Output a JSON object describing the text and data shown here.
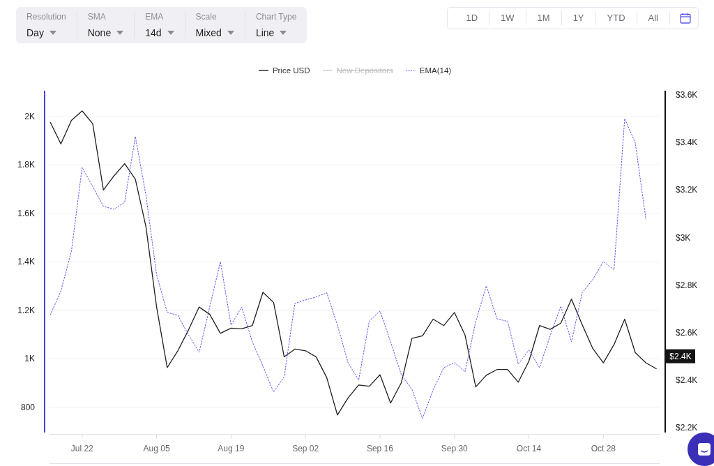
{
  "toolbar": {
    "dropdowns": [
      {
        "label": "Resolution",
        "value": "Day"
      },
      {
        "label": "SMA",
        "value": "None"
      },
      {
        "label": "EMA",
        "value": "14d"
      },
      {
        "label": "Scale",
        "value": "Mixed"
      },
      {
        "label": "Chart Type",
        "value": "Line"
      }
    ]
  },
  "range_buttons": [
    {
      "label": "1D",
      "selected": false
    },
    {
      "label": "1W",
      "selected": false
    },
    {
      "label": "1M",
      "selected": false
    },
    {
      "label": "1Y",
      "selected": false
    },
    {
      "label": "YTD",
      "selected": false
    },
    {
      "label": "All",
      "selected": false
    }
  ],
  "chart": {
    "legend_states": [
      {
        "hidden": false
      },
      {
        "hidden": true
      },
      {
        "hidden": false
      }
    ],
    "chart_data": {
      "type": "line",
      "grid": true,
      "categories": [
        null,
        null,
        null,
        "Jul 22",
        null,
        null,
        null,
        null,
        null,
        null,
        "Aug 05",
        null,
        null,
        null,
        null,
        null,
        null,
        "Aug 19",
        null,
        null,
        null,
        null,
        null,
        null,
        "Sep 02",
        null,
        null,
        null,
        null,
        null,
        null,
        "Sep 16",
        null,
        null,
        null,
        null,
        null,
        null,
        "Sep 30",
        null,
        null,
        null,
        null,
        null,
        null,
        "Oct 14",
        null,
        null,
        null,
        null,
        null,
        null,
        "Oct 28",
        null,
        null,
        null,
        null,
        null
      ],
      "ylim": [
        696,
        2106
      ],
      "yticks": [
        {
          "value": 800,
          "label": "800"
        },
        {
          "value": 1000,
          "label": "1K"
        },
        {
          "value": 1200,
          "label": "1.2K"
        },
        {
          "value": 1400,
          "label": "1.4K"
        },
        {
          "value": 1600,
          "label": "1.6K"
        },
        {
          "value": 1800,
          "label": "1.8K"
        },
        {
          "value": 2000,
          "label": "2K"
        }
      ],
      "y2lim": [
        2177,
        3615
      ],
      "y2ticks": [
        {
          "value": 3600,
          "label": "$3.6K"
        },
        {
          "value": 3400,
          "label": "$3.4K"
        },
        {
          "value": 3200,
          "label": "$3.2K"
        },
        {
          "value": 3000,
          "label": "$3K"
        },
        {
          "value": 2800,
          "label": "$2.8K"
        },
        {
          "value": 2600,
          "label": "$2.6K"
        },
        {
          "value": 2400,
          "label": "$2.4K"
        },
        {
          "value": 2200,
          "label": "$2.2K"
        }
      ],
      "series": [
        {
          "name": "Price USD",
          "color": "#1f1f1f",
          "line_style": "solid",
          "axis": "y2",
          "values": [
            3483,
            3391,
            3490,
            3530,
            3476,
            3197,
            3257,
            3308,
            3243,
            3043,
            2705,
            2450,
            2521,
            2608,
            2705,
            2674,
            2594,
            2616,
            2613,
            2627,
            2767,
            2724,
            2495,
            2528,
            2521,
            2495,
            2407,
            2251,
            2323,
            2377,
            2372,
            2420,
            2301,
            2386,
            2573,
            2584,
            2654,
            2627,
            2682,
            2586,
            2369,
            2418,
            2442,
            2442,
            2389,
            2477,
            2627,
            2611,
            2637,
            2738,
            2632,
            2531,
            2470,
            2547,
            2654,
            2513,
            2470,
            2445
          ]
        },
        {
          "name": "New Depositors",
          "color": "#cfcfcf",
          "line_style": "solid",
          "values": [
            null,
            null,
            null,
            null,
            null,
            null,
            null,
            null,
            null,
            null,
            null,
            null,
            null,
            null,
            null,
            null,
            null,
            null,
            null,
            null,
            null,
            null,
            null,
            null,
            null,
            null,
            null,
            null,
            null,
            null,
            null,
            null,
            null,
            null,
            null,
            null,
            null,
            null,
            null,
            null,
            null,
            null,
            null,
            null,
            null,
            null,
            null,
            null,
            null,
            null,
            null,
            null,
            null,
            null,
            null,
            null,
            null,
            null
          ]
        },
        {
          "name": "EMA(14)",
          "color": "#5b55f0",
          "line_style": "dashed",
          "values": [
            1180,
            1280,
            1445,
            1790,
            1710,
            1629,
            1617,
            1646,
            1917,
            1675,
            1347,
            1191,
            1180,
            1099,
            1027,
            1214,
            1401,
            1139,
            1214,
            1070,
            970,
            863,
            926,
            1229,
            1243,
            1255,
            1272,
            1139,
            984,
            912,
            1157,
            1197,
            1070,
            935,
            875,
            754,
            872,
            964,
            984,
            947,
            1154,
            1301,
            1165,
            1154,
            978,
            1036,
            964,
            1096,
            1217,
            1070,
            1272,
            1327,
            1401,
            1367,
            1991,
            1891,
            1574,
            null
          ]
        }
      ],
      "annotations": [
        "$2.4K"
      ]
    }
  }
}
